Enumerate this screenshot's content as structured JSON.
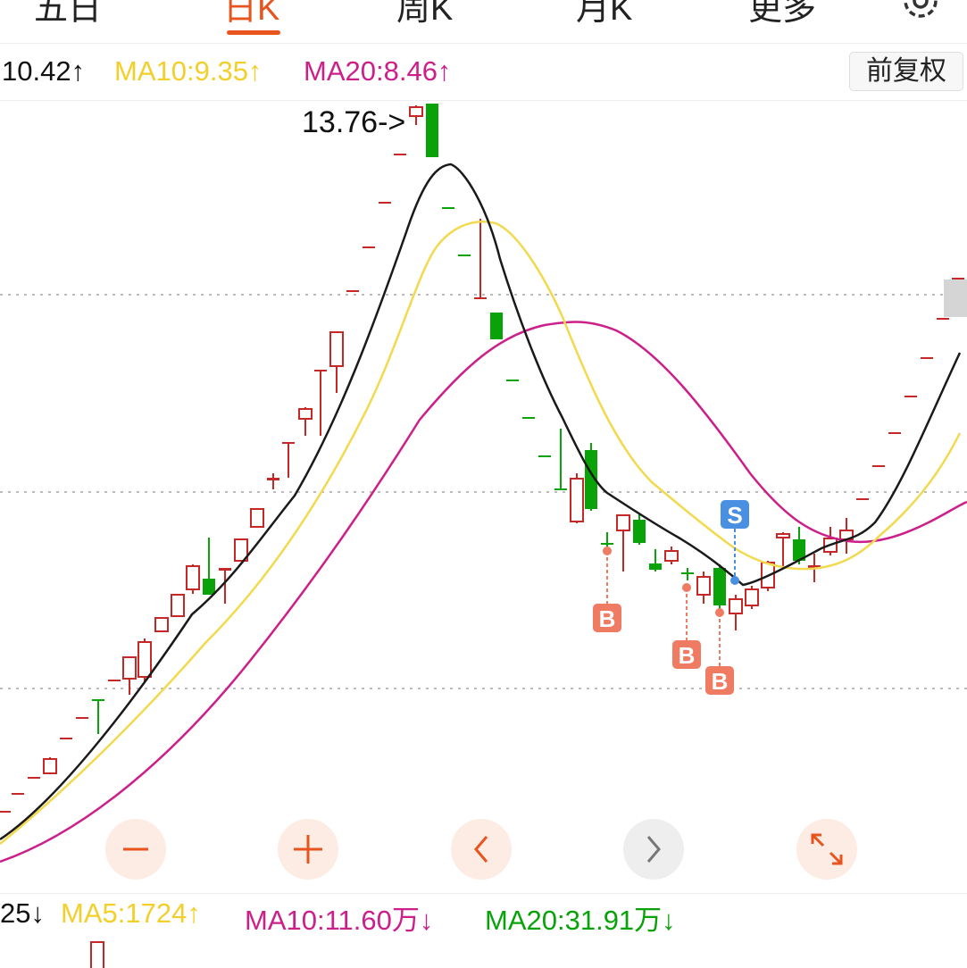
{
  "tabs": [
    {
      "label": "五日",
      "active": false
    },
    {
      "label": "日K",
      "active": true
    },
    {
      "label": "周K",
      "active": false
    },
    {
      "label": "月K",
      "active": false
    },
    {
      "label": "更多",
      "active": false
    }
  ],
  "header": {
    "ma5_text": "10.42↑",
    "ma10_text": "MA10:9.35↑",
    "ma20_text": "MA20:8.46↑",
    "adjust_button": "前复权",
    "settings_icon": "gear-icon"
  },
  "chart": {
    "high_label": "13.76->",
    "colors": {
      "up": "#c62828",
      "down": "#09a309",
      "ma5": "#1a1a1a",
      "ma10": "#f2d94e",
      "ma20": "#cc1f8a",
      "buy": "#f07b63",
      "sell": "#4a90e2"
    },
    "markers": [
      {
        "label": "B",
        "type": "buy"
      },
      {
        "label": "B",
        "type": "buy"
      },
      {
        "label": "B",
        "type": "buy"
      },
      {
        "label": "S",
        "type": "sell"
      }
    ]
  },
  "controls": [
    {
      "name": "zoom-out-button",
      "icon": "minus-icon"
    },
    {
      "name": "zoom-in-button",
      "icon": "plus-icon"
    },
    {
      "name": "prev-button",
      "icon": "chevron-left-icon"
    },
    {
      "name": "next-button",
      "icon": "chevron-right-icon"
    },
    {
      "name": "fullscreen-button",
      "icon": "expand-icon"
    }
  ],
  "volume": {
    "prefix_text": "25↓",
    "ma5_text": "MA5:1724↑",
    "ma10_text": "MA10:11.60万↓",
    "ma20_text": "MA20:31.91万↓"
  }
}
